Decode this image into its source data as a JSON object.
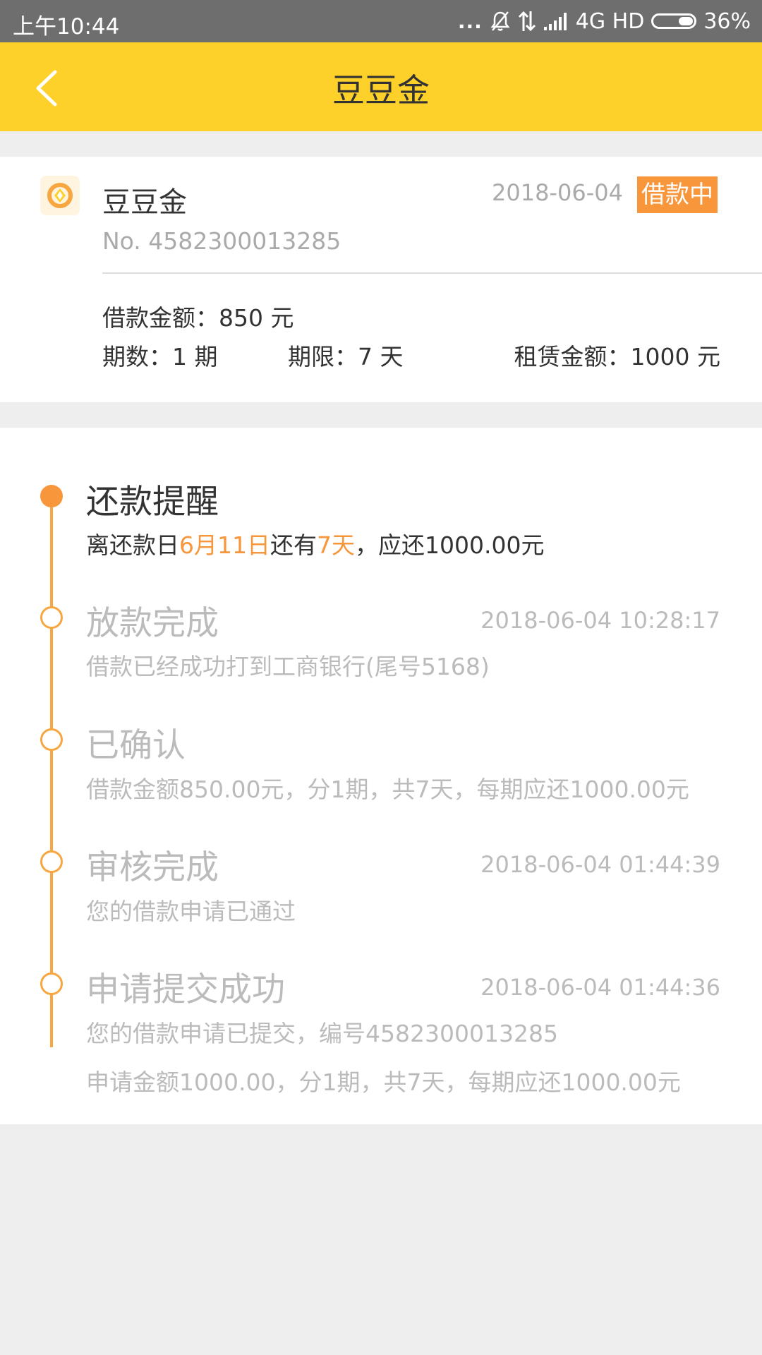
{
  "status_bar": {
    "time": "上午10:44",
    "dots": "...",
    "network": "4G HD",
    "battery": "36%",
    "battery_level": 0.36
  },
  "app_bar": {
    "title": "豆豆金"
  },
  "loan": {
    "name": "豆豆金",
    "date": "2018-06-04",
    "badge": "借款中",
    "number": "No. 4582300013285",
    "amount": "借款金额：850 元",
    "periods": "期数：1 期",
    "term": "期限：7 天",
    "lease_amount": "租赁金额：1000 元"
  },
  "timeline": {
    "reminder": {
      "title": "还款提醒",
      "desc_prefix": "离还款日",
      "due_date": "6月11日",
      "desc_mid": "还有",
      "days_left": "7天",
      "desc_suffix": "，应还1000.00元"
    },
    "disbursed": {
      "title": "放款完成",
      "time": "2018-06-04 10:28:17",
      "desc": "借款已经成功打到工商银行(尾号5168)"
    },
    "confirmed": {
      "title": "已确认",
      "desc": "借款金额850.00元，分1期，共7天，每期应还1000.00元"
    },
    "reviewed": {
      "title": "审核完成",
      "time": "2018-06-04 01:44:39",
      "desc": "您的借款申请已通过"
    },
    "submitted": {
      "title": "申请提交成功",
      "time": "2018-06-04 01:44:36",
      "desc1": "您的借款申请已提交，编号4582300013285",
      "desc2": "申请金额1000.00，分1期，共7天，每期应还1000.00元"
    }
  },
  "colors": {
    "app_bar": "#fdd12a",
    "accent": "#f7963a",
    "status_bar": "#6e6e6e"
  }
}
